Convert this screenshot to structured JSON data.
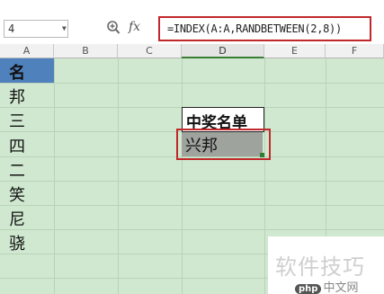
{
  "formula_bar": {
    "name_box": "4",
    "fx_label": "fx",
    "formula": "=INDEX(A:A,RANDBETWEEN(2,8))"
  },
  "columns": [
    "A",
    "B",
    "C",
    "D",
    "E",
    "F"
  ],
  "cells": {
    "column_a": [
      "名",
      "邦",
      "三",
      "四",
      "二",
      "笑",
      "尼",
      "骁"
    ],
    "d_header": "中奖名单",
    "d_result": "兴邦"
  },
  "watermark": {
    "text": "软件技巧",
    "logo_php": "php",
    "logo_rest": "中文网"
  },
  "colors": {
    "grid_fill": "#cfe8cf",
    "highlight_red": "#c0282b",
    "selected_blue": "#4f81bd",
    "result_gray": "#9ea39e"
  }
}
